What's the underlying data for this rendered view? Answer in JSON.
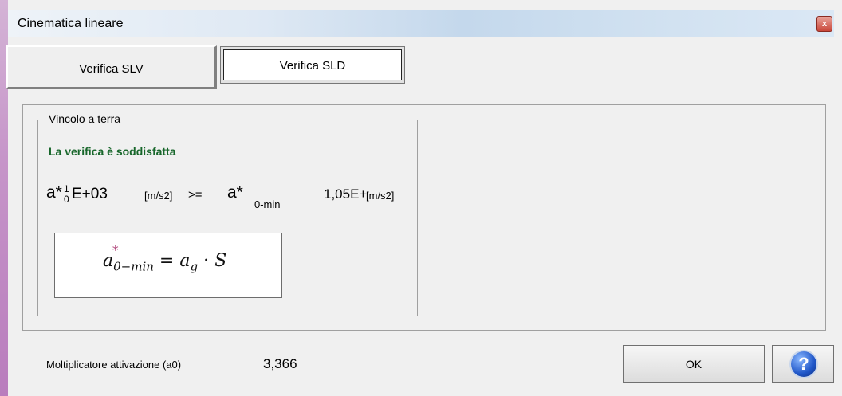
{
  "window": {
    "title": "Cinematica lineare",
    "close_glyph": "x"
  },
  "tabs": [
    {
      "label": "Verifica SLV"
    },
    {
      "label": "Verifica SLD"
    }
  ],
  "group": {
    "legend": "Vincolo a terra",
    "status": "La verifica è soddisfatta",
    "left_symbol": "a*",
    "left_sub": "0",
    "left_overlap": "1",
    "left_value": "E+03",
    "left_unit": "[m/s2]",
    "operator": ">=",
    "right_symbol": "a*",
    "right_sub": "0-min",
    "right_value": "1,05E+",
    "right_unit": "[m/s2]",
    "formula": {
      "lhs_base": "a",
      "lhs_sub": "0−min",
      "lhs_star": "*",
      "equals": "=",
      "rhs_a": "a",
      "rhs_sub": "g",
      "dot": "·",
      "rhs_s": "S"
    }
  },
  "footer": {
    "label": "Moltiplicatore attivazione (a0)",
    "value": "3,366",
    "ok_label": "OK",
    "help_icon": "help-question-icon",
    "help_glyph": "?"
  },
  "colors": {
    "status_green": "#17662a",
    "title_gradient": "#c4d8ec",
    "help_blue": "#1f56c8"
  }
}
